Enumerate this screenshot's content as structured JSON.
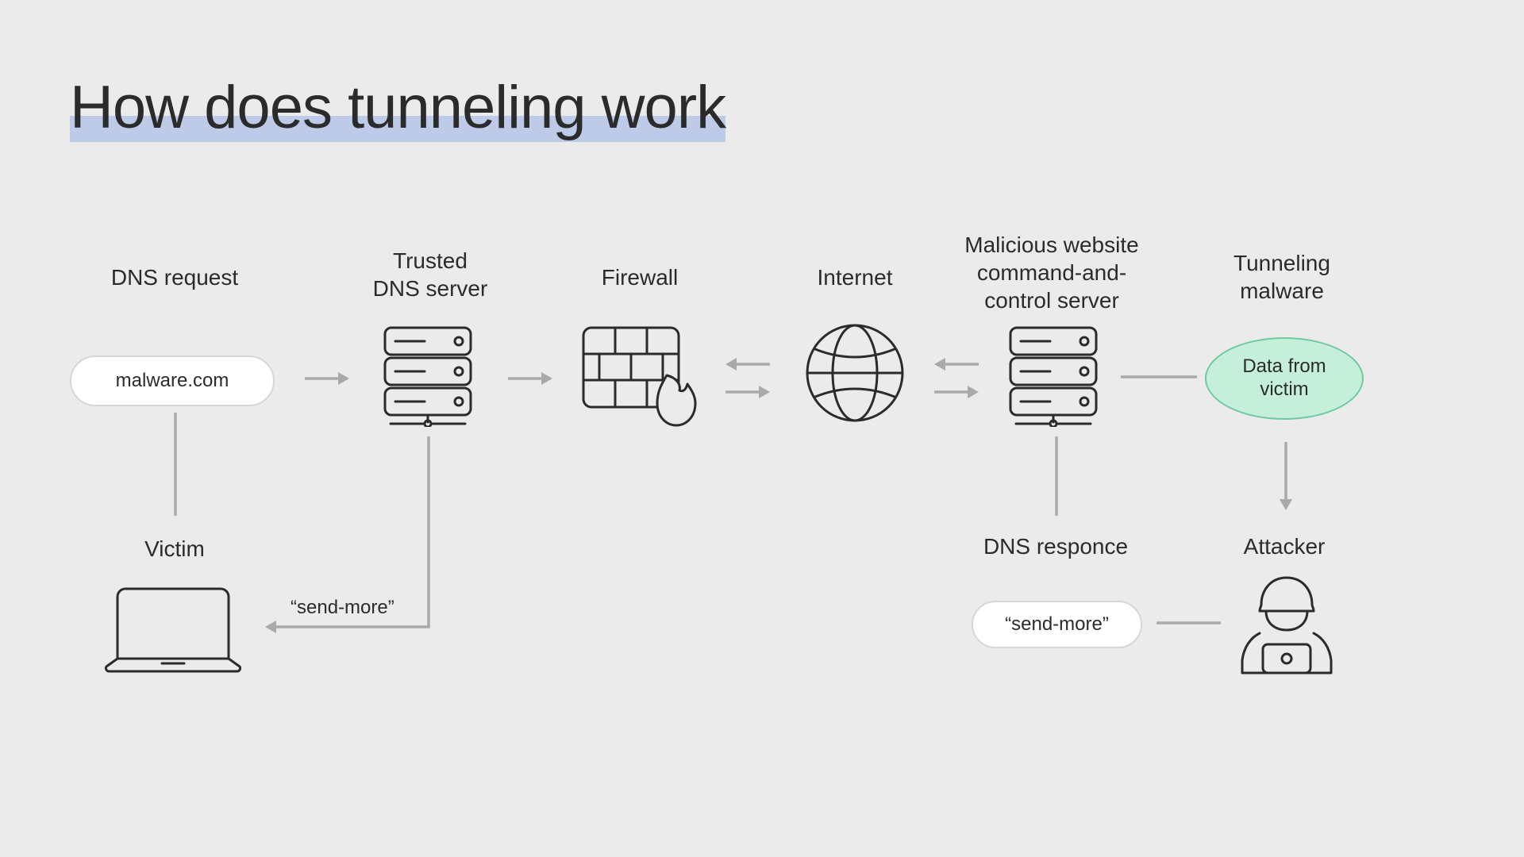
{
  "title": "How does tunneling work",
  "labels": {
    "dns_request": "DNS request",
    "trusted_dns": "Trusted\nDNS server",
    "firewall": "Firewall",
    "internet": "Internet",
    "malicious": "Malicious website\ncommand-and-\ncontrol server",
    "tunneling_malware": "Tunneling\nmalware",
    "victim": "Victim",
    "dns_response": "DNS responce",
    "attacker": "Attacker"
  },
  "pills": {
    "malware_domain": "malware.com",
    "data_from_victim": "Data from\nvictim",
    "send_more_left": "“send-more”",
    "send_more_right": "“send-more”"
  }
}
